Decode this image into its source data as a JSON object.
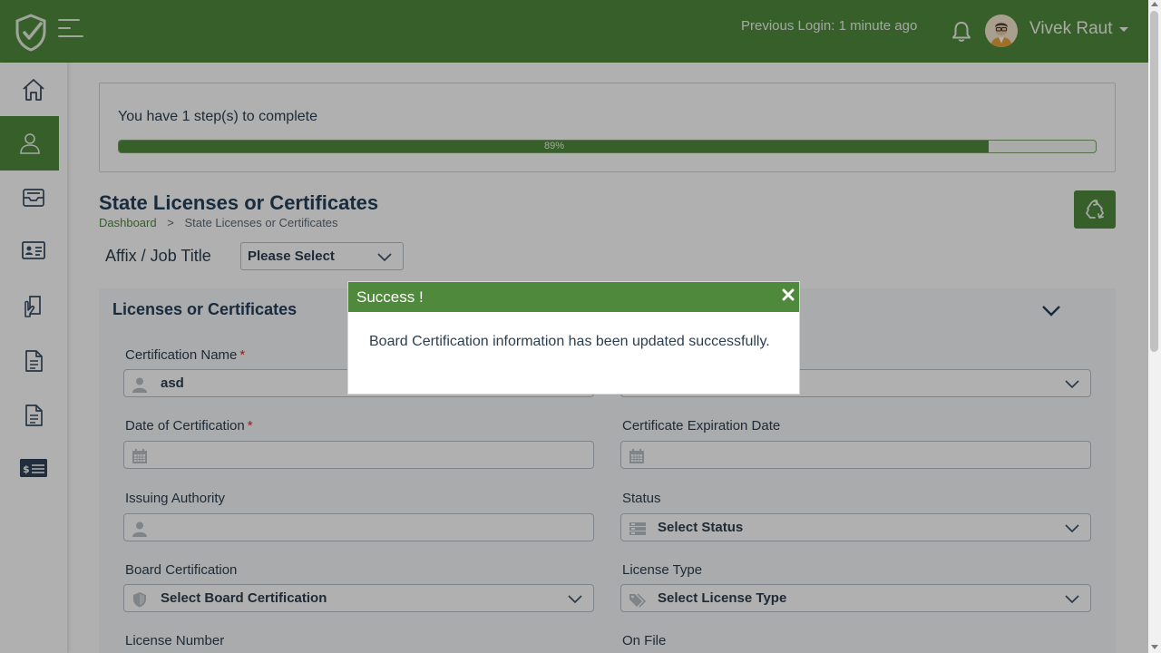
{
  "header": {
    "previous_login": "Previous Login: 1 minute ago",
    "user_name": "Vivek Raut"
  },
  "sidebar": {
    "items": [
      {
        "icon": "home-icon"
      },
      {
        "icon": "user-icon",
        "active": true
      },
      {
        "icon": "inbox-icon"
      },
      {
        "icon": "id-card-icon"
      },
      {
        "icon": "document-hand-icon"
      },
      {
        "icon": "file-icon"
      },
      {
        "icon": "file-icon"
      },
      {
        "icon": "billing-card-icon"
      }
    ]
  },
  "progress": {
    "text": "You have 1 step(s) to complete",
    "percent_label": "89%",
    "value": 0.89
  },
  "page": {
    "title": "State Licenses or Certificates",
    "breadcrumb": {
      "home": "Dashboard",
      "separator": ">",
      "current": "State Licenses or Certificates"
    }
  },
  "affix": {
    "label": "Affix / Job Title",
    "value": "Please Select"
  },
  "section": {
    "title": "Licenses or Certificates",
    "fields": {
      "certification_name": {
        "label": "Certification Name",
        "required": "*",
        "value": "asd"
      },
      "date_of_certification": {
        "label": "Date of Certification",
        "required": "*",
        "value": ""
      },
      "certificate_expiration": {
        "label": "Certificate Expiration Date",
        "value": ""
      },
      "issuing_authority": {
        "label": "Issuing Authority",
        "value": ""
      },
      "status": {
        "label": "Status",
        "value": "Select Status"
      },
      "board_certification": {
        "label": "Board Certification",
        "value": "Select Board Certification"
      },
      "license_type": {
        "label": "License Type",
        "value": "Select License Type"
      },
      "license_number": {
        "label": "License Number"
      },
      "on_file": {
        "label": "On File"
      }
    }
  },
  "modal": {
    "title": "Success !",
    "message": "Board Certification information has been updated successfully."
  },
  "colors": {
    "brand_green": "#4f8a3c",
    "text_dark": "#2d3e50",
    "required_red": "#c0392b"
  }
}
